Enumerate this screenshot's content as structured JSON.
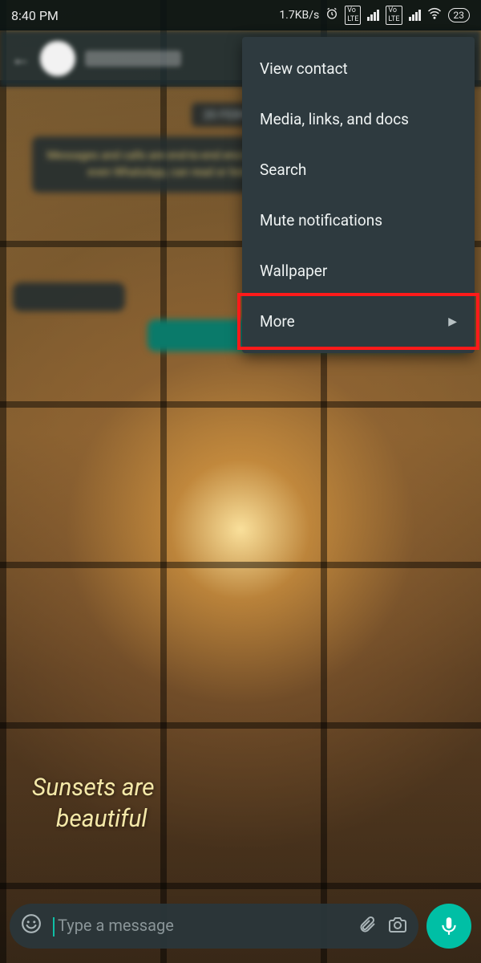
{
  "status_bar": {
    "time": "8:40 PM",
    "net_speed": "1.7KB/s",
    "battery": "23"
  },
  "chat": {
    "date_chip": "20 FEBRUARY",
    "encryption_notice": "Messages and calls are end-to-end encrypted. No one outside of this chat, not even WhatsApp, can read or listen to them. Tap to learn more.",
    "wallpaper_caption_line1": "Sunsets are",
    "wallpaper_caption_line2": "beautiful"
  },
  "menu": {
    "items": [
      {
        "label": "View contact",
        "has_chevron": false
      },
      {
        "label": "Media, links, and docs",
        "has_chevron": false
      },
      {
        "label": "Search",
        "has_chevron": false
      },
      {
        "label": "Mute notifications",
        "has_chevron": false
      },
      {
        "label": "Wallpaper",
        "has_chevron": false
      },
      {
        "label": "More",
        "has_chevron": true
      }
    ],
    "highlighted_index": 5
  },
  "input": {
    "placeholder": "Type a message"
  }
}
